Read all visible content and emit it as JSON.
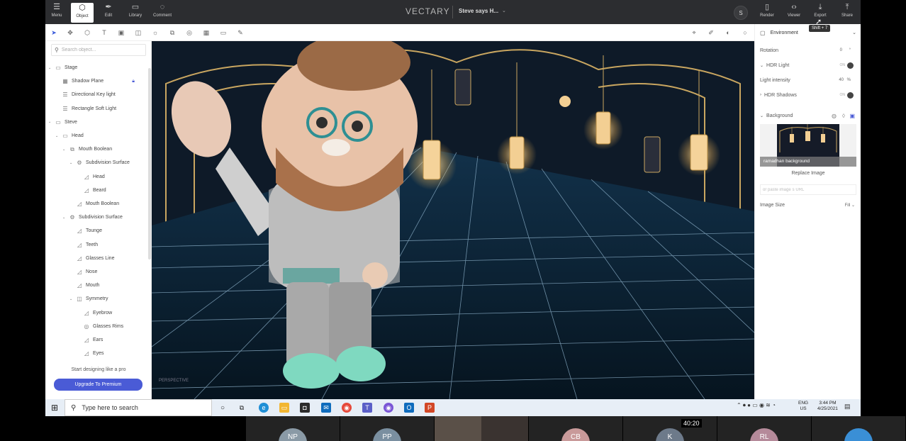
{
  "header": {
    "menu_label": "Menu",
    "object_label": "Object",
    "edit_label": "Edit",
    "library_label": "Library",
    "comment_label": "Comment",
    "brand": "VECTARY",
    "project_title": "Steve says H...",
    "avatar_initial": "S",
    "render_label": "Render",
    "viewer_label": "Viewer",
    "export_label": "Export",
    "share_label": "Share",
    "export_tooltip": "Shift + 7"
  },
  "sidebar": {
    "search_placeholder": "Search object...",
    "tree": [
      {
        "label": "Stage",
        "icon": "folder-icon",
        "depth": 0,
        "arrow": true
      },
      {
        "label": "Shadow Plane",
        "icon": "plane-icon",
        "depth": 1,
        "arrow": false,
        "locked": true
      },
      {
        "label": "Directional Key light",
        "icon": "light-icon",
        "depth": 1,
        "arrow": false
      },
      {
        "label": "Rectangle Soft Light",
        "icon": "light-icon",
        "depth": 1,
        "arrow": false
      },
      {
        "label": "Steve",
        "icon": "folder-icon",
        "depth": 0,
        "arrow": true
      },
      {
        "label": "Head",
        "icon": "folder-icon",
        "depth": 1,
        "arrow": true
      },
      {
        "label": "Mouth Boolean",
        "icon": "boolean-icon",
        "depth": 2,
        "arrow": true
      },
      {
        "label": "Subdivision Surface",
        "icon": "subdivision-icon",
        "depth": 3,
        "arrow": true
      },
      {
        "label": "Head",
        "icon": "mesh-icon",
        "depth": 4,
        "arrow": false
      },
      {
        "label": "Beard",
        "icon": "mesh-icon",
        "depth": 4,
        "arrow": false
      },
      {
        "label": "Mouth Boolean",
        "icon": "mesh-icon",
        "depth": 3,
        "arrow": false
      },
      {
        "label": "Subdivision Surface",
        "icon": "subdivision-icon",
        "depth": 2,
        "arrow": true
      },
      {
        "label": "Tounge",
        "icon": "mesh-icon",
        "depth": 3,
        "arrow": false
      },
      {
        "label": "Teeth",
        "icon": "mesh-icon",
        "depth": 3,
        "arrow": false
      },
      {
        "label": "Glasses Line",
        "icon": "mesh-icon",
        "depth": 3,
        "arrow": false
      },
      {
        "label": "Nose",
        "icon": "mesh-icon",
        "depth": 3,
        "arrow": false
      },
      {
        "label": "Mouth",
        "icon": "mesh-icon",
        "depth": 3,
        "arrow": false
      },
      {
        "label": "Symmetry",
        "icon": "symmetry-icon",
        "depth": 3,
        "arrow": true
      },
      {
        "label": "Eyebrow",
        "icon": "mesh-icon",
        "depth": 4,
        "arrow": false
      },
      {
        "label": "Glasses Rims",
        "icon": "ring-icon",
        "depth": 4,
        "arrow": false
      },
      {
        "label": "Ears",
        "icon": "mesh-icon",
        "depth": 4,
        "arrow": false
      },
      {
        "label": "Eyes",
        "icon": "mesh-icon",
        "depth": 4,
        "arrow": false
      }
    ],
    "promo_text": "Start designing like a pro",
    "upgrade_label": "Upgrade To Premium"
  },
  "viewport": {
    "camera_label": "PERSPECTIVE"
  },
  "panel": {
    "section_title": "Environment",
    "rotation_label": "Rotation",
    "rotation_value": "0",
    "hdr_light_label": "HDR Light",
    "hdr_light_state": "ON",
    "light_intensity_label": "Light intensity",
    "light_intensity_value": "40",
    "light_intensity_unit": "%",
    "hdr_shadows_label": "HDR Shadows",
    "hdr_shadows_state": "ON",
    "background_label": "Background",
    "background_image_name": "ramadhan background",
    "replace_image_label": "Replace Image",
    "url_placeholder": "or paste image´s URL",
    "image_size_label": "Image Size",
    "image_size_value": "Fill"
  },
  "taskbar": {
    "search_placeholder": "Type here to search",
    "lang_top": "ENG",
    "lang_bottom": "US",
    "time": "3:44 PM",
    "date": "4/25/2021"
  },
  "meeting": {
    "timer": "40:20",
    "participants": [
      "NP",
      "PP",
      "",
      "",
      "CB",
      "K",
      "RL",
      ""
    ]
  },
  "colors": {
    "accent": "#4a5bd6",
    "header_bg": "#2c2d30",
    "scene_bg": "#0d1a26",
    "lantern_glow": "#f7d9a0"
  }
}
